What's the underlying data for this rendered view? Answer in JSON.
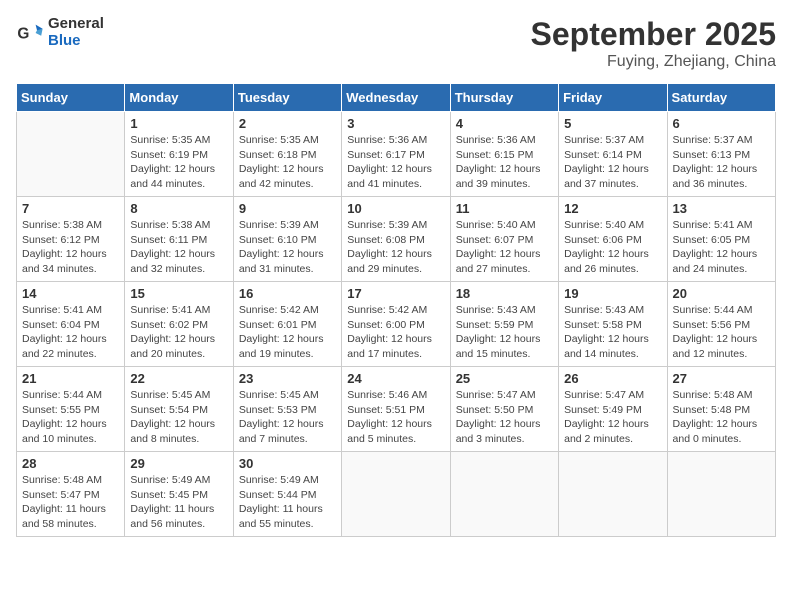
{
  "header": {
    "logo_line1": "General",
    "logo_line2": "Blue",
    "month_title": "September 2025",
    "location": "Fuying, Zhejiang, China"
  },
  "weekdays": [
    "Sunday",
    "Monday",
    "Tuesday",
    "Wednesday",
    "Thursday",
    "Friday",
    "Saturday"
  ],
  "weeks": [
    [
      {
        "day": "",
        "info": ""
      },
      {
        "day": "1",
        "info": "Sunrise: 5:35 AM\nSunset: 6:19 PM\nDaylight: 12 hours\nand 44 minutes."
      },
      {
        "day": "2",
        "info": "Sunrise: 5:35 AM\nSunset: 6:18 PM\nDaylight: 12 hours\nand 42 minutes."
      },
      {
        "day": "3",
        "info": "Sunrise: 5:36 AM\nSunset: 6:17 PM\nDaylight: 12 hours\nand 41 minutes."
      },
      {
        "day": "4",
        "info": "Sunrise: 5:36 AM\nSunset: 6:15 PM\nDaylight: 12 hours\nand 39 minutes."
      },
      {
        "day": "5",
        "info": "Sunrise: 5:37 AM\nSunset: 6:14 PM\nDaylight: 12 hours\nand 37 minutes."
      },
      {
        "day": "6",
        "info": "Sunrise: 5:37 AM\nSunset: 6:13 PM\nDaylight: 12 hours\nand 36 minutes."
      }
    ],
    [
      {
        "day": "7",
        "info": "Sunrise: 5:38 AM\nSunset: 6:12 PM\nDaylight: 12 hours\nand 34 minutes."
      },
      {
        "day": "8",
        "info": "Sunrise: 5:38 AM\nSunset: 6:11 PM\nDaylight: 12 hours\nand 32 minutes."
      },
      {
        "day": "9",
        "info": "Sunrise: 5:39 AM\nSunset: 6:10 PM\nDaylight: 12 hours\nand 31 minutes."
      },
      {
        "day": "10",
        "info": "Sunrise: 5:39 AM\nSunset: 6:08 PM\nDaylight: 12 hours\nand 29 minutes."
      },
      {
        "day": "11",
        "info": "Sunrise: 5:40 AM\nSunset: 6:07 PM\nDaylight: 12 hours\nand 27 minutes."
      },
      {
        "day": "12",
        "info": "Sunrise: 5:40 AM\nSunset: 6:06 PM\nDaylight: 12 hours\nand 26 minutes."
      },
      {
        "day": "13",
        "info": "Sunrise: 5:41 AM\nSunset: 6:05 PM\nDaylight: 12 hours\nand 24 minutes."
      }
    ],
    [
      {
        "day": "14",
        "info": "Sunrise: 5:41 AM\nSunset: 6:04 PM\nDaylight: 12 hours\nand 22 minutes."
      },
      {
        "day": "15",
        "info": "Sunrise: 5:41 AM\nSunset: 6:02 PM\nDaylight: 12 hours\nand 20 minutes."
      },
      {
        "day": "16",
        "info": "Sunrise: 5:42 AM\nSunset: 6:01 PM\nDaylight: 12 hours\nand 19 minutes."
      },
      {
        "day": "17",
        "info": "Sunrise: 5:42 AM\nSunset: 6:00 PM\nDaylight: 12 hours\nand 17 minutes."
      },
      {
        "day": "18",
        "info": "Sunrise: 5:43 AM\nSunset: 5:59 PM\nDaylight: 12 hours\nand 15 minutes."
      },
      {
        "day": "19",
        "info": "Sunrise: 5:43 AM\nSunset: 5:58 PM\nDaylight: 12 hours\nand 14 minutes."
      },
      {
        "day": "20",
        "info": "Sunrise: 5:44 AM\nSunset: 5:56 PM\nDaylight: 12 hours\nand 12 minutes."
      }
    ],
    [
      {
        "day": "21",
        "info": "Sunrise: 5:44 AM\nSunset: 5:55 PM\nDaylight: 12 hours\nand 10 minutes."
      },
      {
        "day": "22",
        "info": "Sunrise: 5:45 AM\nSunset: 5:54 PM\nDaylight: 12 hours\nand 8 minutes."
      },
      {
        "day": "23",
        "info": "Sunrise: 5:45 AM\nSunset: 5:53 PM\nDaylight: 12 hours\nand 7 minutes."
      },
      {
        "day": "24",
        "info": "Sunrise: 5:46 AM\nSunset: 5:51 PM\nDaylight: 12 hours\nand 5 minutes."
      },
      {
        "day": "25",
        "info": "Sunrise: 5:47 AM\nSunset: 5:50 PM\nDaylight: 12 hours\nand 3 minutes."
      },
      {
        "day": "26",
        "info": "Sunrise: 5:47 AM\nSunset: 5:49 PM\nDaylight: 12 hours\nand 2 minutes."
      },
      {
        "day": "27",
        "info": "Sunrise: 5:48 AM\nSunset: 5:48 PM\nDaylight: 12 hours\nand 0 minutes."
      }
    ],
    [
      {
        "day": "28",
        "info": "Sunrise: 5:48 AM\nSunset: 5:47 PM\nDaylight: 11 hours\nand 58 minutes."
      },
      {
        "day": "29",
        "info": "Sunrise: 5:49 AM\nSunset: 5:45 PM\nDaylight: 11 hours\nand 56 minutes."
      },
      {
        "day": "30",
        "info": "Sunrise: 5:49 AM\nSunset: 5:44 PM\nDaylight: 11 hours\nand 55 minutes."
      },
      {
        "day": "",
        "info": ""
      },
      {
        "day": "",
        "info": ""
      },
      {
        "day": "",
        "info": ""
      },
      {
        "day": "",
        "info": ""
      }
    ]
  ]
}
